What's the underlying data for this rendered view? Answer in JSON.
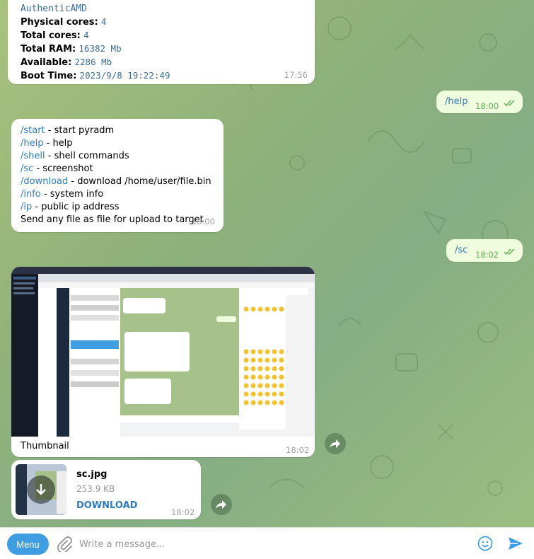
{
  "sysinfo": {
    "cpu_line": "AuthenticAMD",
    "rows": [
      {
        "label": "Physical cores:",
        "value": "4"
      },
      {
        "label": "Total cores:",
        "value": "4"
      },
      {
        "label": "Total RAM:",
        "value": "16382 Mb"
      },
      {
        "label": "Available:",
        "value": "2286 Mb"
      },
      {
        "label": "Boot Time:",
        "value": "2023/9/8 19:22:49"
      }
    ],
    "time": "17:56"
  },
  "help_request": {
    "text": "/help",
    "time": "18:00"
  },
  "help_reply": {
    "lines": [
      {
        "cmd": "/start",
        "desc": " - start pyradm"
      },
      {
        "cmd": "/help",
        "desc": " - help"
      },
      {
        "cmd": "/shell",
        "desc": " - shell commands"
      },
      {
        "cmd": "/sc",
        "desc": " - screenshot"
      },
      {
        "cmd": "/download",
        "desc": " - download /home/user/file.bin"
      },
      {
        "cmd": "/info",
        "desc": " - system info"
      },
      {
        "cmd": "/ip",
        "desc": " - public ip address"
      }
    ],
    "footer": "Send any file as file for upload to target",
    "time": "18:00"
  },
  "sc_request": {
    "text": "/sc",
    "time": "18:02"
  },
  "photo_message": {
    "caption": "Thumbnail",
    "time": "18:02"
  },
  "file_message": {
    "name": "sc.jpg",
    "size": "253.9 KB",
    "action": "DOWNLOAD",
    "time": "18:02"
  },
  "input_bar": {
    "menu_label": "Menu",
    "placeholder": "Write a message..."
  },
  "colors": {
    "accent": "#3f9de1",
    "outgoing_bubble": "#effdde",
    "check": "#5fb14e",
    "link": "#2f7cc1"
  }
}
